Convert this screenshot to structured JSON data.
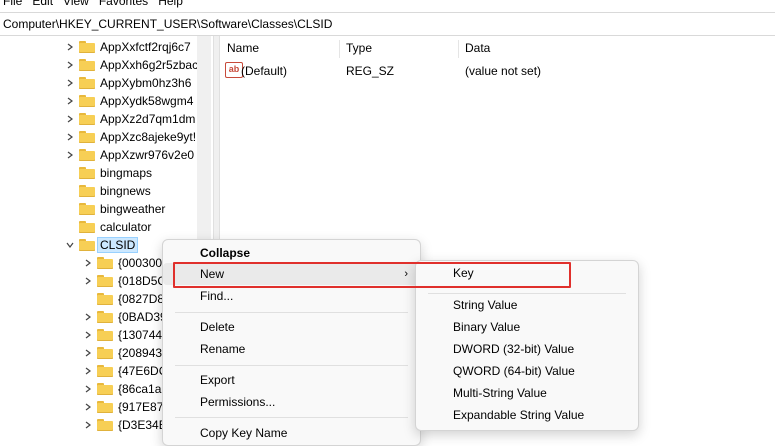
{
  "menubar": [
    "File",
    "Edit",
    "View",
    "Favorites",
    "Help"
  ],
  "address": "Computer\\HKEY_CURRENT_USER\\Software\\Classes\\CLSID",
  "tree": {
    "items": [
      "AppXxfctf2rqj6c7",
      "AppXxh6g2r5zbac",
      "AppXybm0hz3h6",
      "AppXydk58wgm4",
      "AppXz2d7qm1dm",
      "AppXzc8ajeke9yt!",
      "AppXzwr976v2e0",
      "bingmaps",
      "bingnews",
      "bingweather",
      "calculator",
      "CLSID"
    ],
    "children": [
      "{000300",
      "{018D5C",
      "{0827D8",
      "{0BAD39",
      "{130744",
      "{208943",
      "{47E6DC",
      "{86ca1a",
      "{917E87",
      "{D3E34B"
    ]
  },
  "list": {
    "headers": {
      "name": "Name",
      "type": "Type",
      "data": "Data"
    },
    "rows": [
      {
        "icon": "ab",
        "name": "(Default)",
        "type": "REG_SZ",
        "data": "(value not set)"
      }
    ]
  },
  "context_menu": {
    "collapse": "Collapse",
    "new": "New",
    "find": "Find...",
    "delete": "Delete",
    "rename": "Rename",
    "export": "Export",
    "permissions": "Permissions...",
    "copy_key_name": "Copy Key Name"
  },
  "submenu": {
    "key": "Key",
    "string": "String Value",
    "binary": "Binary Value",
    "dword": "DWORD (32-bit) Value",
    "qword": "QWORD (64-bit) Value",
    "multi": "Multi-String Value",
    "expandable": "Expandable String Value"
  },
  "colors": {
    "highlight": "#e0302c",
    "selection": "#cce8ff",
    "folder": "#f7cf55"
  }
}
